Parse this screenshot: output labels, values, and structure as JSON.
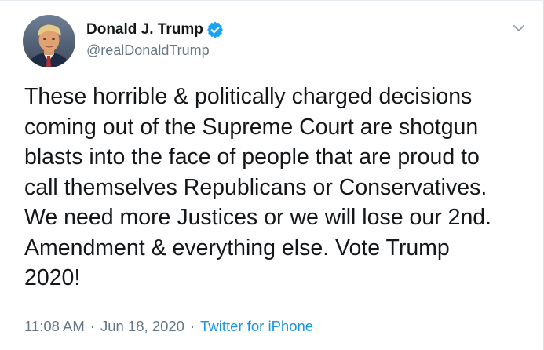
{
  "author": {
    "display_name": "Donald J. Trump",
    "handle": "@realDonaldTrump",
    "verified": true
  },
  "tweet": {
    "lines": [
      "These horrible & politically charged decisions",
      "coming out of the Supreme Court are shotgun",
      "blasts into the face of people that are proud to",
      "call themselves Republicans or Conservatives.",
      "We need more Justices or we will lose our 2nd.",
      "Amendment & everything else. Vote Trump",
      "2020!"
    ]
  },
  "meta": {
    "time": "11:08 AM",
    "separator": "·",
    "date": "Jun 18, 2020",
    "source": "Twitter for iPhone"
  },
  "icons": {
    "verified": "verified-badge-icon",
    "menu": "chevron-down-icon"
  },
  "colors": {
    "text": "#14171a",
    "secondary": "#657786",
    "link": "#1b95e0",
    "verified": "#1da1f2"
  }
}
